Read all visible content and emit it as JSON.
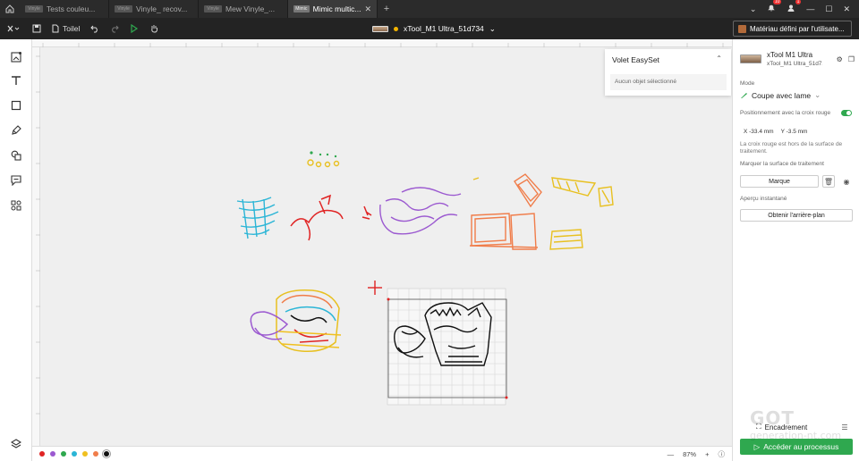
{
  "tabs": [
    {
      "thumb": "Vinyle",
      "label": "Tests couleu...",
      "active": false
    },
    {
      "thumb": "Vinyle",
      "label": "Vinyle_ recov...",
      "active": false
    },
    {
      "thumb": "Vinyle",
      "label": "Mew Vinyle_...",
      "active": false
    },
    {
      "thumb": "Mimic",
      "label": "Mimic multic...",
      "active": true
    }
  ],
  "notifications": {
    "badge1": "10",
    "badge2": "1"
  },
  "toolbar": {
    "file_label": "Toilel"
  },
  "device": {
    "name": "xTool_M1 Ultra_51d734",
    "status_color": "#f4b400"
  },
  "material": {
    "label": "Matériau défini par l'utilisate..."
  },
  "easyset": {
    "title": "Volet EasySet",
    "empty": "Aucun objet sélectionné"
  },
  "right_panel": {
    "machine_name": "xTool M1 Ultra",
    "machine_sub": "xTool_M1 Ultra_51d734",
    "mode_label": "Mode",
    "mode_value": "Coupe avec lame",
    "positioning_label": "Positionnement avec la croix rouge",
    "x_value": "X -33.4 mm",
    "y_value": "Y -3.5 mm",
    "warning": "La croix rouge est hors de la surface de traitement.",
    "mark_label": "Marquer la surface de traitement",
    "mark_button": "Marque",
    "preview_label": "Aperçu instantané",
    "background_button": "Obtenir l'arrière-plan",
    "frame_label": "Encadrement",
    "process_button": "Accéder au processus"
  },
  "bottom": {
    "swatches": [
      "#e02424",
      "#9b59d0",
      "#2fa84f",
      "#2bb5d6",
      "#f0c020",
      "#f07d4a",
      "#111111"
    ],
    "zoom": "87%"
  },
  "watermark": {
    "main": "GOT",
    "sub": "generation-nt.com"
  }
}
